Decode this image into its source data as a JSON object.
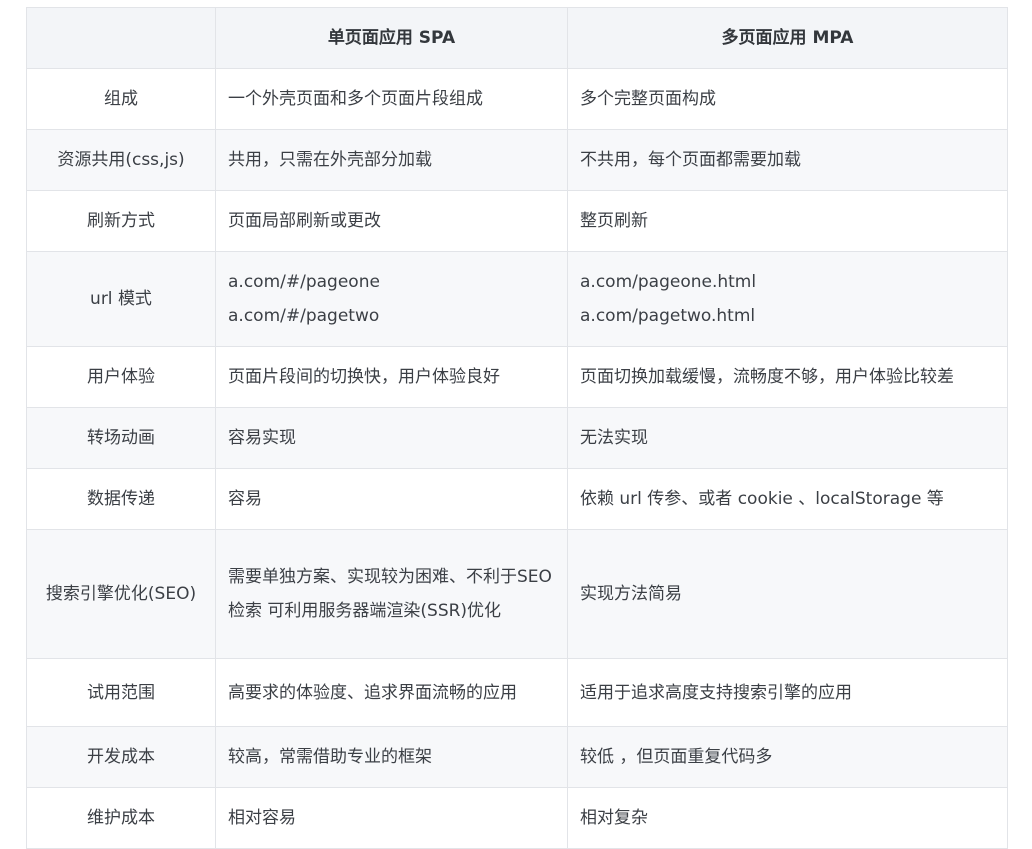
{
  "header": {
    "col0": "",
    "col1": "单页面应用 SPA",
    "col2": "多页面应用 MPA"
  },
  "rows": [
    {
      "key": "组成",
      "spa": [
        "一个外壳页面和多个页面片段组成"
      ],
      "mpa": [
        "多个完整页面构成"
      ]
    },
    {
      "key": "资源共用(css,js)",
      "spa": [
        "共用，只需在外壳部分加载"
      ],
      "mpa": [
        "不共用，每个页面都需要加载"
      ]
    },
    {
      "key": "刷新方式",
      "spa": [
        "页面局部刷新或更改"
      ],
      "mpa": [
        "整页刷新"
      ]
    },
    {
      "key": "url  模式",
      "spa": [
        "a.com/#/pageone",
        "a.com/#/pagetwo"
      ],
      "mpa": [
        "a.com/pageone.html",
        "a.com/pagetwo.html"
      ]
    },
    {
      "key": "用户体验",
      "spa": [
        "页面片段间的切换快，用户体验良好"
      ],
      "mpa": [
        "页面切换加载缓慢，流畅度不够，用户体验比较差"
      ]
    },
    {
      "key": "转场动画",
      "spa": [
        "容易实现"
      ],
      "mpa": [
        "无法实现"
      ]
    },
    {
      "key": "数据传递",
      "spa": [
        "容易"
      ],
      "mpa": [
        "依赖  url 传参、或者 cookie  、localStorage 等"
      ]
    },
    {
      "key": "搜索引擎优化(SEO)",
      "spa": [
        "需要单独方案、实现较为困难、不利于SEO 检索  可利用服务器端渲染(SSR)优化"
      ],
      "mpa": [
        "实现方法简易"
      ]
    },
    {
      "key": "试用范围",
      "spa": [
        "高要求的体验度、追求界面流畅的应用"
      ],
      "mpa": [
        "适用于追求高度支持搜索引擎的应用"
      ]
    },
    {
      "key": "开发成本",
      "spa": [
        "较高，常需借助专业的框架"
      ],
      "mpa": [
        "较低  ，但页面重复代码多"
      ]
    },
    {
      "key": "维护成本",
      "spa": [
        "相对容易"
      ],
      "mpa": [
        "相对复杂"
      ]
    }
  ]
}
